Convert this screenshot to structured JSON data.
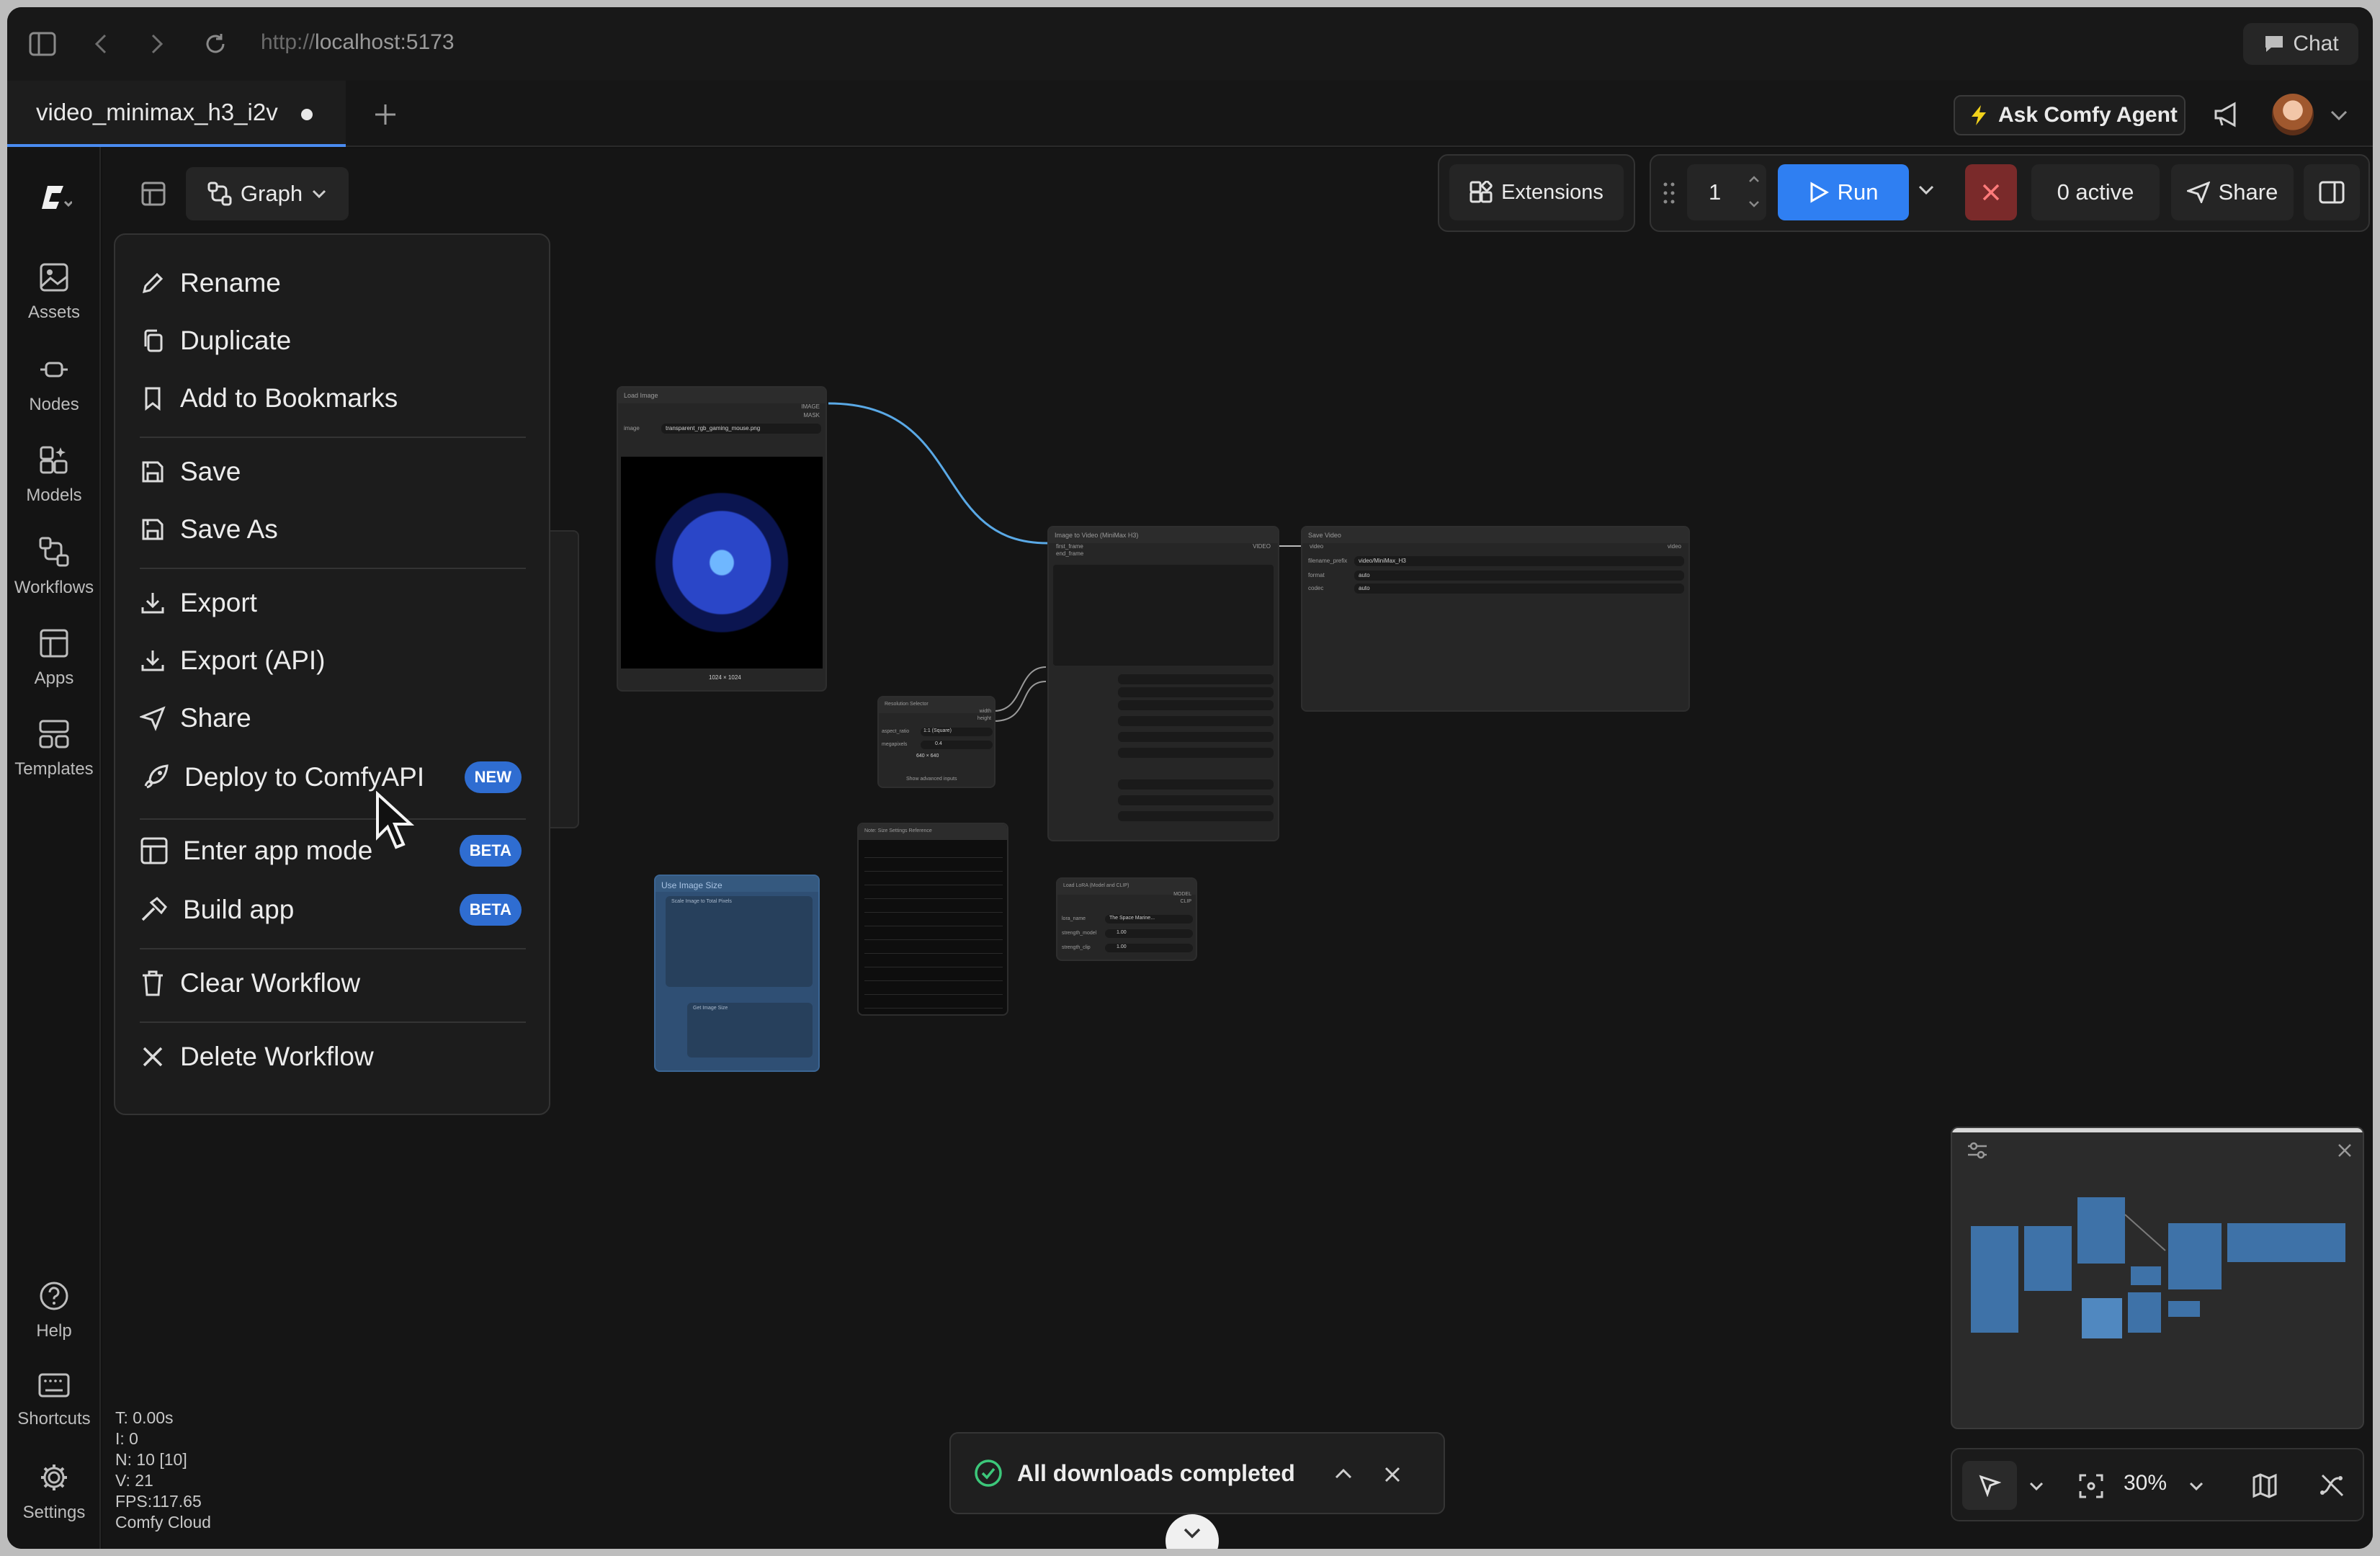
{
  "browser": {
    "url_prefix": "http://",
    "url_host": "localhost:5173",
    "chat_label": "Chat"
  },
  "tab": {
    "title": "video_minimax_h3_i2v",
    "new_tab_label": "+"
  },
  "header": {
    "ask_label": "Ask Comfy Agent"
  },
  "sidebar": {
    "items": [
      {
        "label": "Assets",
        "icon": "image-icon"
      },
      {
        "label": "Nodes",
        "icon": "plug-icon"
      },
      {
        "label": "Models",
        "icon": "models-icon"
      },
      {
        "label": "Workflows",
        "icon": "workflows-icon"
      },
      {
        "label": "Apps",
        "icon": "apps-icon"
      },
      {
        "label": "Templates",
        "icon": "templates-icon"
      }
    ],
    "bottom": [
      {
        "label": "Help",
        "icon": "help-icon"
      },
      {
        "label": "Shortcuts",
        "icon": "keyboard-icon"
      },
      {
        "label": "Settings",
        "icon": "gear-icon"
      }
    ]
  },
  "toolbar": {
    "graph_label": "Graph",
    "extensions_label": "Extensions",
    "queue_count": "1",
    "run_label": "Run",
    "active_label": "0 active",
    "share_label": "Share"
  },
  "menu": {
    "items": [
      {
        "label": "Rename"
      },
      {
        "label": "Duplicate"
      },
      {
        "label": "Add to Bookmarks"
      },
      {
        "label": "Save"
      },
      {
        "label": "Save As"
      },
      {
        "label": "Export"
      },
      {
        "label": "Export (API)"
      },
      {
        "label": "Share"
      },
      {
        "label": "Deploy to ComfyAPI",
        "badge": "NEW"
      },
      {
        "label": "Enter app mode",
        "badge": "BETA"
      },
      {
        "label": "Build app",
        "badge": "BETA"
      },
      {
        "label": "Clear Workflow"
      },
      {
        "label": "Delete Workflow"
      }
    ]
  },
  "nodes": {
    "load_image": {
      "title": "Load Image",
      "image_label": "image",
      "file": "transparent_rgb_gaming_mouse.png",
      "out_image": "IMAGE",
      "out_mask": "MASK",
      "size": "1024 × 1024"
    },
    "i2v": {
      "title": "Image to Video (MiniMax H3)",
      "in1": "first_frame",
      "in2": "end_frame",
      "out": "VIDEO"
    },
    "save_video": {
      "title": "Save Video",
      "in": "video",
      "out": "video",
      "prefix_label": "filename_prefix",
      "prefix": "video/MiniMax_H3",
      "format_label": "format",
      "format": "auto",
      "codec_label": "codec",
      "codec": "auto"
    },
    "resolution": {
      "title": "Resolution Selector",
      "aspect_label": "aspect_ratio",
      "aspect": "1:1 (Square)",
      "mp_label": "megapixels",
      "mp": "0.4",
      "dims": "640 × 640",
      "adv": "Show advanced inputs",
      "out_w": "width",
      "out_h": "height"
    },
    "notes": {
      "title": "Note: Size Settings Reference"
    },
    "use_image_size": {
      "title": "Use Image Size",
      "sub1": "Scale Image to Total Pixels",
      "sub2": "Get Image Size"
    },
    "lora": {
      "title": "Load LoRA (Model and CLIP)",
      "lora_label": "lora_name",
      "lora": "The Space Marine...",
      "sm_label": "strength_model",
      "sm": "1.00",
      "sc_label": "strength_clip",
      "sc": "1.00",
      "out_model": "MODEL",
      "out_clip": "CLIP"
    }
  },
  "stats": {
    "t": "T: 0.00s",
    "i": "I: 0",
    "n": "N: 10 [10]",
    "v": "V: 21",
    "fps": "FPS:117.65",
    "env": "Comfy Cloud"
  },
  "toast": {
    "message": "All downloads completed"
  },
  "bottom_controls": {
    "zoom": "30%"
  },
  "colors": {
    "accent": "#2f7ff2",
    "danger": "#c23a3a",
    "badge": "#2f6dd1"
  }
}
